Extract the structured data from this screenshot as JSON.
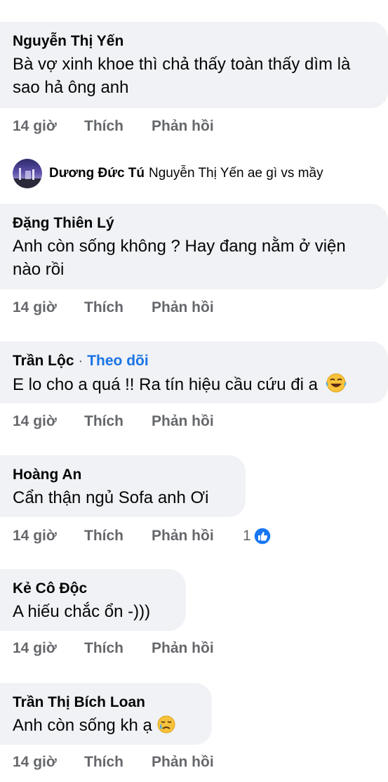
{
  "comments": [
    {
      "name": "Nguyễn Thị Yến",
      "text_lines": [
        "Bà vợ xinh khoe thì chả thấy toàn thấy dìm là",
        "sao hả ông anh"
      ],
      "time": "14 giờ",
      "like": "Thích",
      "reply": "Phản hồi"
    },
    {
      "name": "Đặng Thiên Lý",
      "text_lines": [
        "Anh còn sống không ? Hay đang nằm ở viện",
        "nào rồi"
      ],
      "time": "14 giờ",
      "like": "Thích",
      "reply": "Phản hồi"
    },
    {
      "name": "Trần Lộc",
      "separator": "·",
      "follow": "Theo dõi",
      "text": "E lo cho a quá !! Ra tín hiệu cầu cứu đi a",
      "emoji": "laughing-tears-emoji",
      "time": "14 giờ",
      "like": "Thích",
      "reply": "Phản hồi"
    },
    {
      "name": "Hoàng An",
      "text": "Cẩn thận ngủ Sofa anh Ơi",
      "time": "14 giờ",
      "like": "Thích",
      "reply": "Phản hồi",
      "reaction_count": "1",
      "reaction_icon": "like-icon"
    },
    {
      "name": "Kẻ Cô Độc",
      "text": "A hiếu chắc ổn -)))",
      "time": "14 giờ",
      "like": "Thích",
      "reply": "Phản hồi"
    },
    {
      "name": "Trần Thị Bích Loan",
      "text": "Anh còn sống kh ạ",
      "emoji": "crying-face-emoji",
      "time": "14 giờ",
      "like": "Thích",
      "reply": "Phản hồi"
    }
  ],
  "reply": {
    "name": "Dương Đức Tú",
    "text": "Nguyễn Thị Yến ae gì vs mầy",
    "avatar": "avatar"
  },
  "colors": {
    "bubble": "#f0f2f5",
    "meta": "#65676b",
    "link": "#1b74e4",
    "like_blue": "#1877f2"
  }
}
